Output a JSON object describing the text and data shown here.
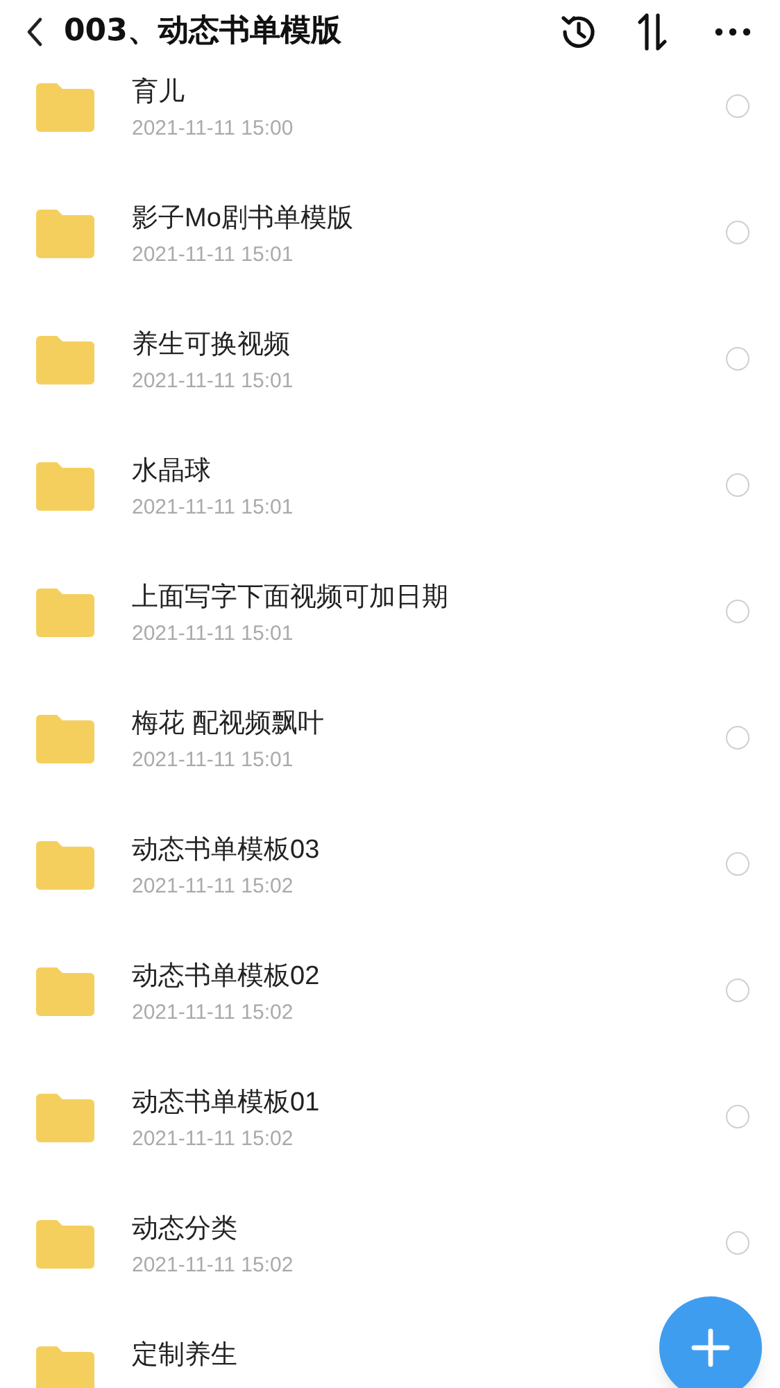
{
  "header": {
    "title": "003、动态书单模版"
  },
  "items": [
    {
      "name": "育儿",
      "date": "2021-11-11 15:00",
      "selected": false
    },
    {
      "name": "影子Mo剧书单模版",
      "date": "2021-11-11 15:01",
      "selected": false
    },
    {
      "name": "养生可换视频",
      "date": "2021-11-11 15:01",
      "selected": false
    },
    {
      "name": "水晶球",
      "date": "2021-11-11 15:01",
      "selected": false
    },
    {
      "name": "上面写字下面视频可加日期",
      "date": "2021-11-11 15:01",
      "selected": false
    },
    {
      "name": "梅花 配视频飘叶",
      "date": "2021-11-11 15:01",
      "selected": false
    },
    {
      "name": "动态书单模板03",
      "date": "2021-11-11 15:02",
      "selected": false
    },
    {
      "name": "动态书单模板02",
      "date": "2021-11-11 15:02",
      "selected": false
    },
    {
      "name": "动态书单模板01",
      "date": "2021-11-11 15:02",
      "selected": false
    },
    {
      "name": "动态分类",
      "date": "2021-11-11 15:02",
      "selected": false
    },
    {
      "name": "定制养生"
    }
  ]
}
